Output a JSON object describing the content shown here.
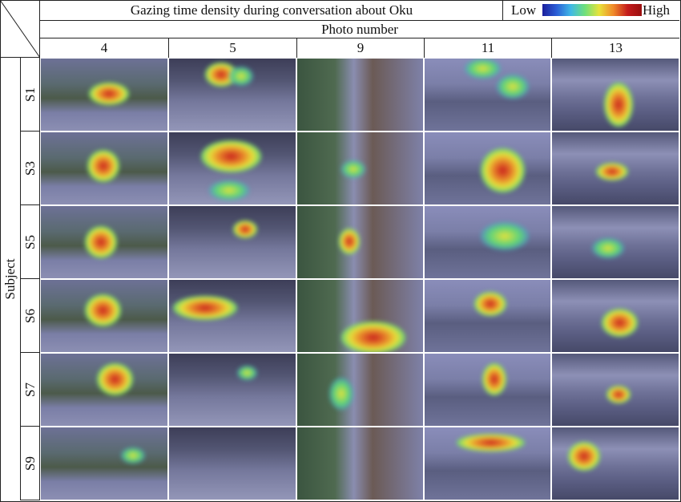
{
  "title": "Gazing time density during conversation about Oku",
  "legend": {
    "low": "Low",
    "high": "High"
  },
  "column_group_label": "Photo number",
  "row_group_label": "Subject",
  "photo_numbers": [
    "4",
    "5",
    "9",
    "11",
    "13"
  ],
  "subjects": [
    "S1",
    "S3",
    "S5",
    "S6",
    "S7",
    "S9"
  ]
}
